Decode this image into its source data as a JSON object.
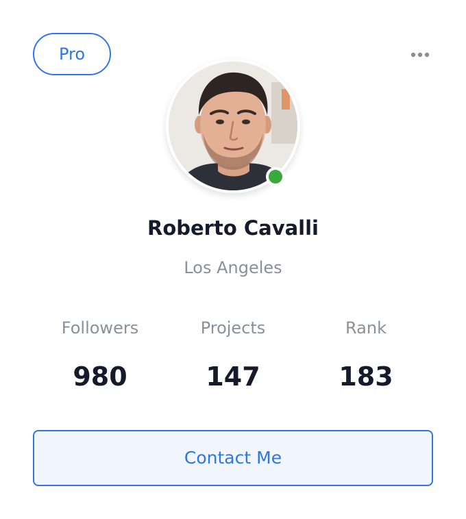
{
  "card": {
    "badge": "Pro",
    "menu_icon": "more-horizontal-icon",
    "avatar_icon": "profile-photo",
    "status": "online",
    "status_color": "#3aa93a",
    "name": "Roberto Cavalli",
    "location": "Los Angeles",
    "stats": [
      {
        "label": "Followers",
        "value": "980"
      },
      {
        "label": "Projects",
        "value": "147"
      },
      {
        "label": "Rank",
        "value": "183"
      }
    ],
    "contact_label": "Contact Me"
  },
  "colors": {
    "accent": "#2f74e8",
    "button_bg": "#f1f6fe",
    "text_dark": "#161b2c",
    "text_muted": "#8a909a"
  }
}
